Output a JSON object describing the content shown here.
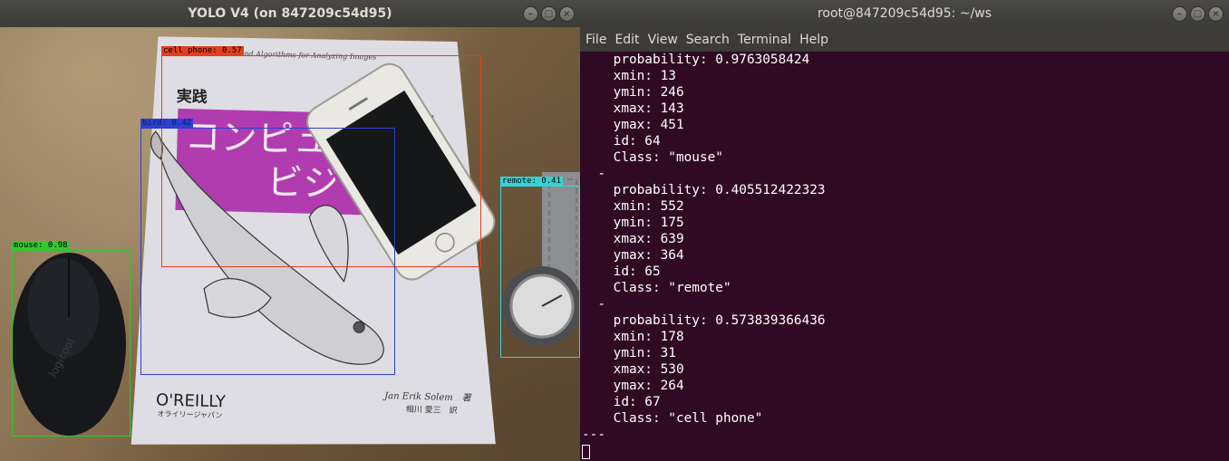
{
  "yolo_window": {
    "title": "YOLO V4 (on 847209c54d95)",
    "book_title_top": "Tools and Algorithms for Analyzing Images",
    "book_title_jp1": "実践",
    "book_title_jp2": "コンピュ",
    "book_title_jp3": "ビジ",
    "book_publisher": "O'REILLY",
    "book_publisher_jp": "オライリージャパン",
    "book_author1": "Jan Erik Solem　著",
    "book_author2": "相川 愛三　訳",
    "mouse_brand": "logicool",
    "detections": [
      {
        "label": "cell phone: 0.57",
        "color": "#e43e1c"
      },
      {
        "label": "bird: 0.42",
        "color": "#2b3fd6"
      },
      {
        "label": "remote: 0.41",
        "color": "#35d3d3"
      },
      {
        "label": "mouse: 0.98",
        "color": "#32c832"
      }
    ]
  },
  "terminal_window": {
    "title": "root@847209c54d95: ~/ws",
    "menu": [
      "File",
      "Edit",
      "View",
      "Search",
      "Terminal",
      "Help"
    ],
    "lines": [
      "    probability: 0.9763058424",
      "    xmin: 13",
      "    ymin: 246",
      "    xmax: 143",
      "    ymax: 451",
      "    id: 64",
      "    Class: \"mouse\"",
      "  -",
      "    probability: 0.405512422323",
      "    xmin: 552",
      "    ymin: 175",
      "    xmax: 639",
      "    ymax: 364",
      "    id: 65",
      "    Class: \"remote\"",
      "  -",
      "    probability: 0.573839366436",
      "    xmin: 178",
      "    ymin: 31",
      "    xmax: 530",
      "    ymax: 264",
      "    id: 67",
      "    Class: \"cell phone\"",
      "---"
    ]
  },
  "colors": {
    "terminal_bg": "#300a24",
    "titlebar": "#3c3b37"
  },
  "icons": [
    "minimize-icon",
    "maximize-icon",
    "close-icon"
  ]
}
